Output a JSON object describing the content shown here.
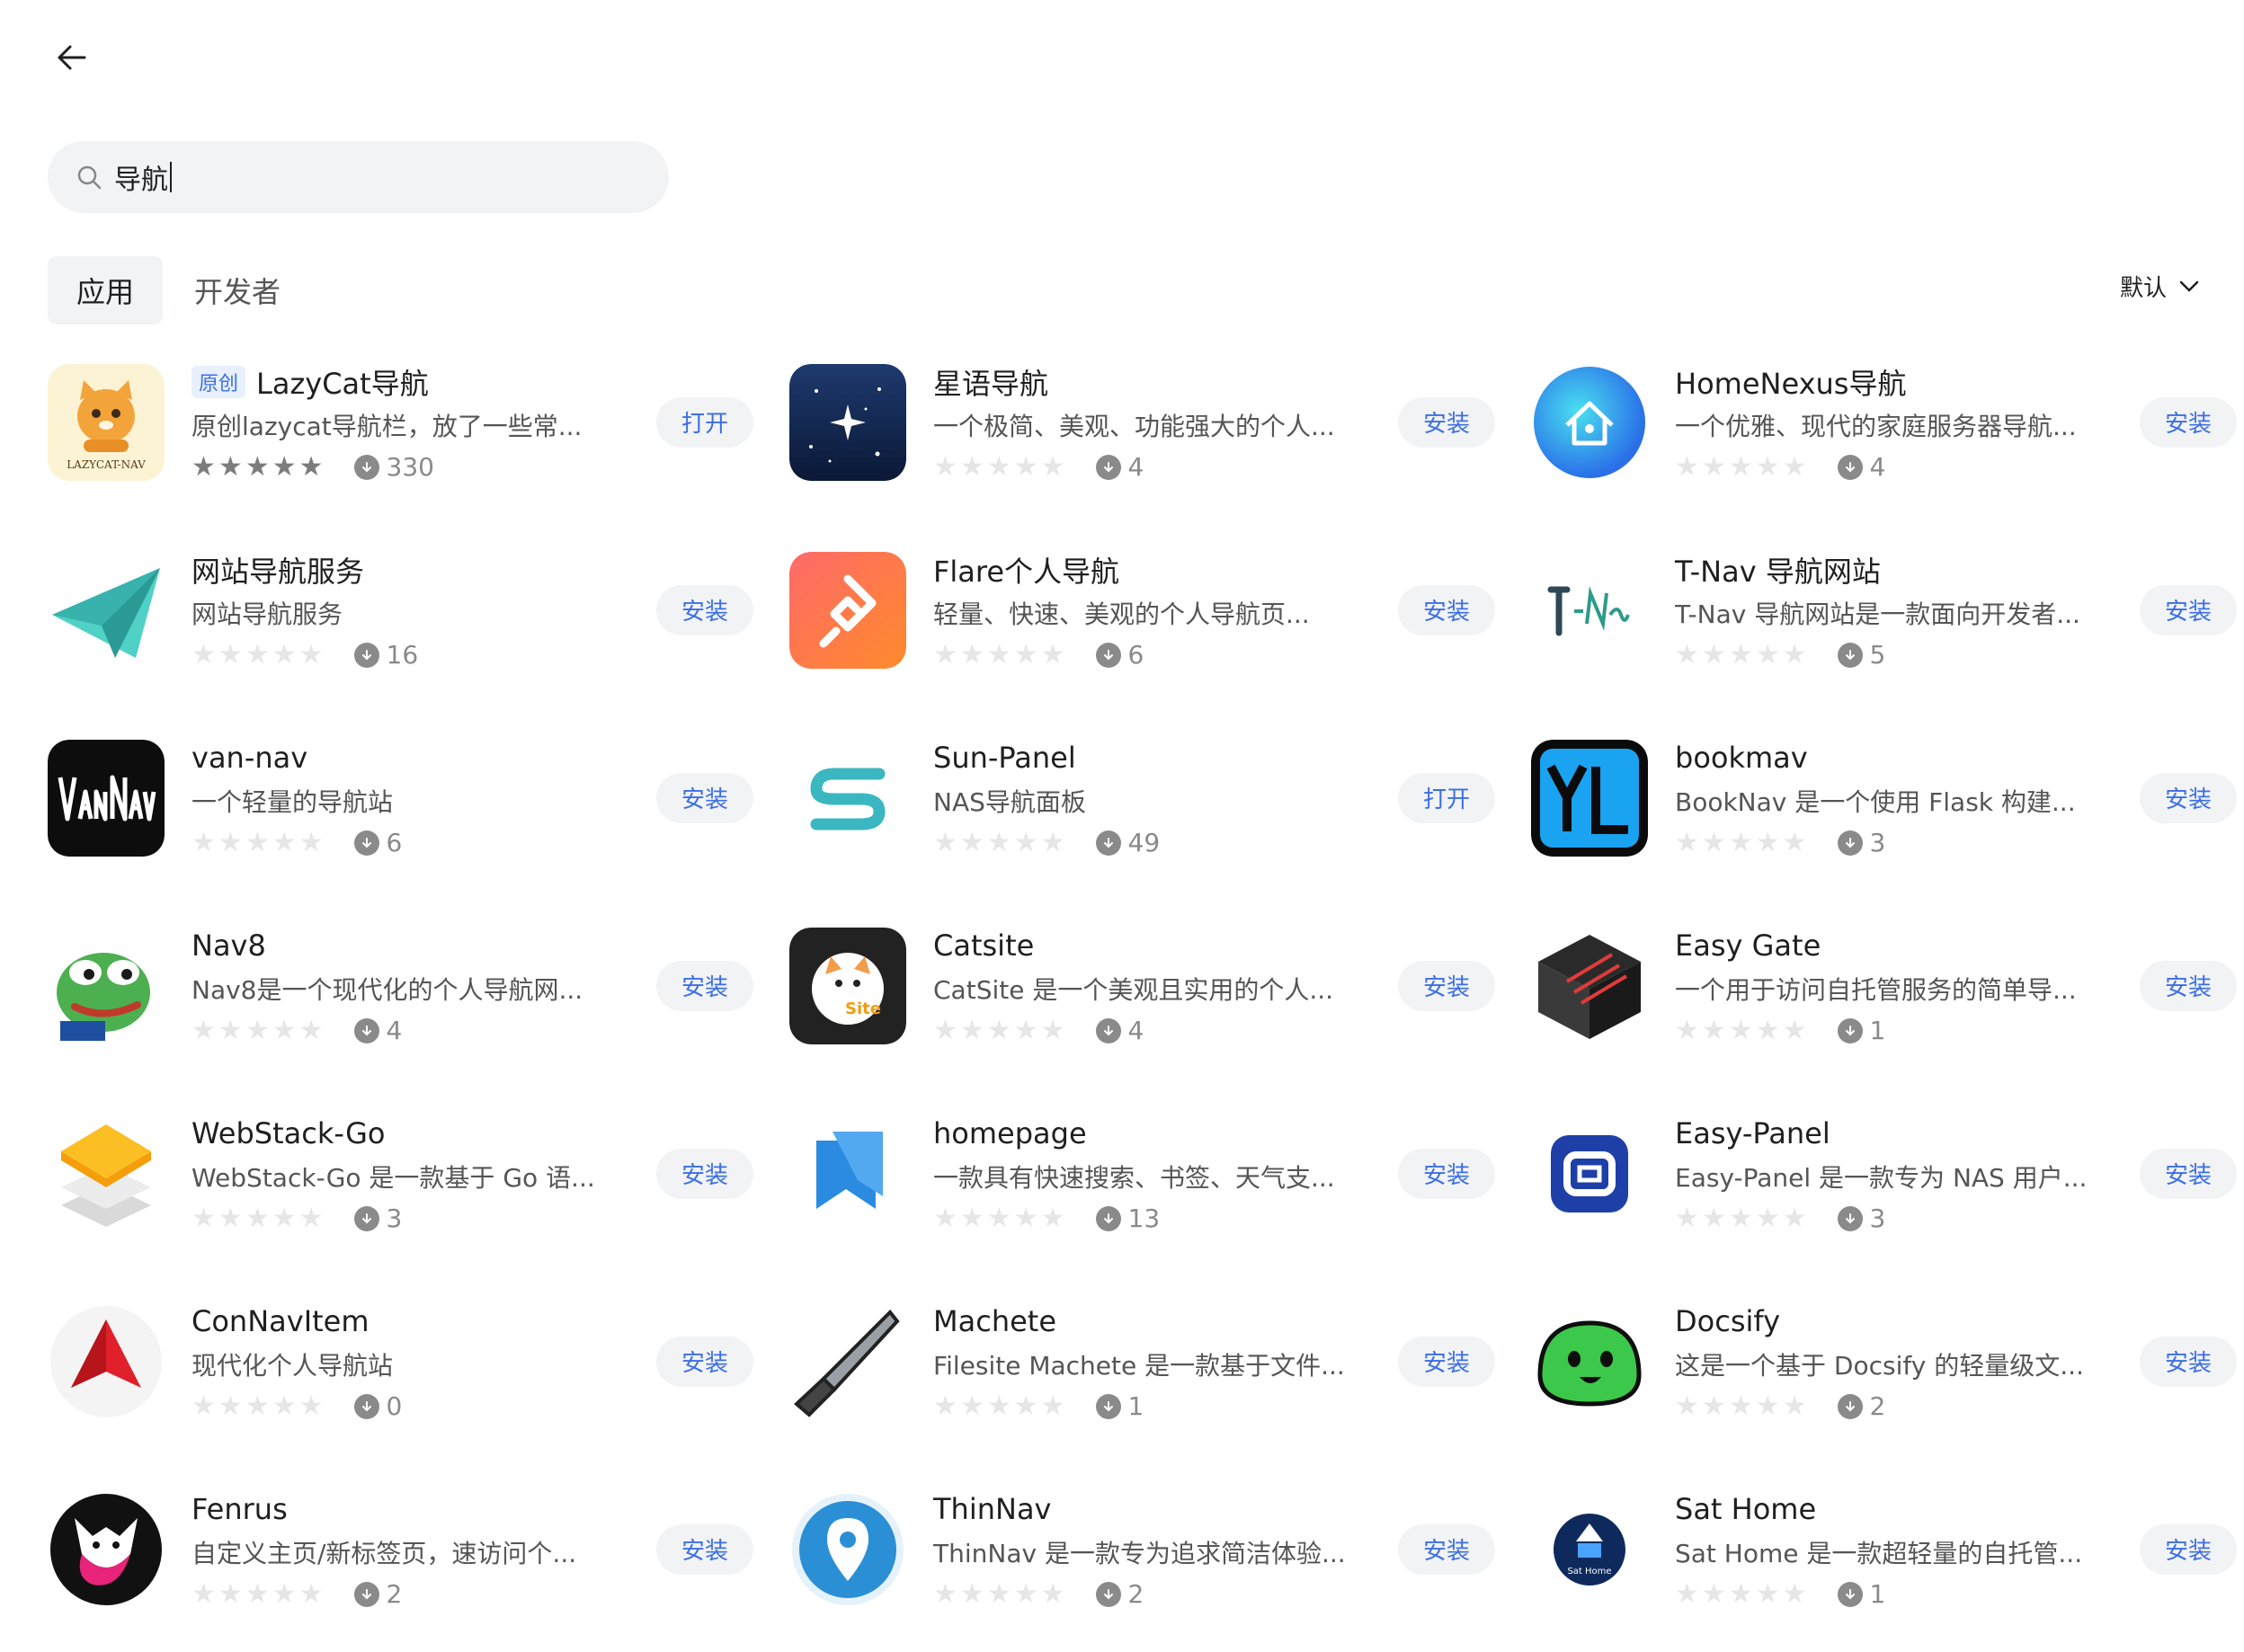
{
  "search": {
    "query": "导航"
  },
  "tabs": [
    {
      "label": "应用"
    },
    {
      "label": "开发者"
    }
  ],
  "sort": {
    "label": "默认"
  },
  "apps": [
    {
      "name": "LazyCat导航",
      "badge": "原创",
      "desc": "原创lazycat导航栏，放了一些常...",
      "downloads": "330",
      "action": "打开",
      "rated": true,
      "icon": "lazycat-icon"
    },
    {
      "name": "星语导航",
      "desc": "一个极简、美观、功能强大的个人...",
      "downloads": "4",
      "action": "安装",
      "icon": "starry-sky-icon"
    },
    {
      "name": "HomeNexus导航",
      "desc": "一个优雅、现代的家庭服务器导航...",
      "downloads": "4",
      "action": "安装",
      "icon": "home-nexus-icon"
    },
    {
      "name": "网站导航服务",
      "desc": "网站导航服务",
      "downloads": "16",
      "action": "安装",
      "icon": "paper-plane-icon"
    },
    {
      "name": "Flare个人导航",
      "desc": "轻量、快速、美观的个人导航页...",
      "downloads": "6",
      "action": "安装",
      "icon": "flare-icon"
    },
    {
      "name": "T-Nav 导航网站",
      "desc": "T-Nav 导航网站是一款面向开发者...",
      "downloads": "5",
      "action": "安装",
      "icon": "t-nav-icon"
    },
    {
      "name": "van-nav",
      "desc": "一个轻量的导航站",
      "downloads": "6",
      "action": "安装",
      "icon": "van-nav-icon"
    },
    {
      "name": "Sun-Panel",
      "desc": "NAS导航面板",
      "downloads": "49",
      "action": "打开",
      "icon": "sun-panel-icon"
    },
    {
      "name": "bookmav",
      "desc": "BookNav 是一个使用 Flask 构建...",
      "downloads": "3",
      "action": "安装",
      "icon": "yl-icon"
    },
    {
      "name": "Nav8",
      "desc": "Nav8是一个现代化的个人导航网...",
      "downloads": "4",
      "action": "安装",
      "icon": "frog-icon"
    },
    {
      "name": "Catsite",
      "desc": "CatSite 是一个美观且实用的个人...",
      "downloads": "4",
      "action": "安装",
      "icon": "catsite-icon"
    },
    {
      "name": "Easy Gate",
      "desc": "一个用于访问自托管服务的简单导...",
      "downloads": "1",
      "action": "安装",
      "icon": "cube-icon"
    },
    {
      "name": "WebStack-Go",
      "desc": "WebStack-Go 是一款基于 Go 语...",
      "downloads": "3",
      "action": "安装",
      "icon": "stack-icon"
    },
    {
      "name": "homepage",
      "desc": "一款具有快速搜索、书签、天气支...",
      "downloads": "13",
      "action": "安装",
      "icon": "bookmark-icon"
    },
    {
      "name": "Easy-Panel",
      "desc": "Easy-Panel 是一款专为 NAS 用户...",
      "downloads": "3",
      "action": "安装",
      "icon": "easy-panel-icon"
    },
    {
      "name": "ConNavItem",
      "desc": "现代化个人导航站",
      "downloads": "0",
      "action": "安装",
      "icon": "red-arrow-icon"
    },
    {
      "name": "Machete",
      "desc": "Filesite Machete 是一款基于文件...",
      "downloads": "1",
      "action": "安装",
      "icon": "machete-icon"
    },
    {
      "name": "Docsify",
      "desc": "这是一个基于 Docsify 的轻量级文...",
      "downloads": "2",
      "action": "安装",
      "icon": "green-blob-icon"
    },
    {
      "name": "Fenrus",
      "desc": "自定义主页/新标签页，速访问个...",
      "downloads": "2",
      "action": "安装",
      "icon": "fox-icon"
    },
    {
      "name": "ThinNav",
      "desc": "ThinNav 是一款专为追求简洁体验...",
      "downloads": "2",
      "action": "安装",
      "icon": "location-pin-icon"
    },
    {
      "name": "Sat Home",
      "desc": "Sat Home 是一款超轻量的自托管...",
      "downloads": "1",
      "action": "安装",
      "icon": "sat-home-icon"
    }
  ],
  "icon_text": {
    "lazycat": "LAZYCAT-NAV",
    "catsite": "Site",
    "sathome": "Sat Home"
  }
}
